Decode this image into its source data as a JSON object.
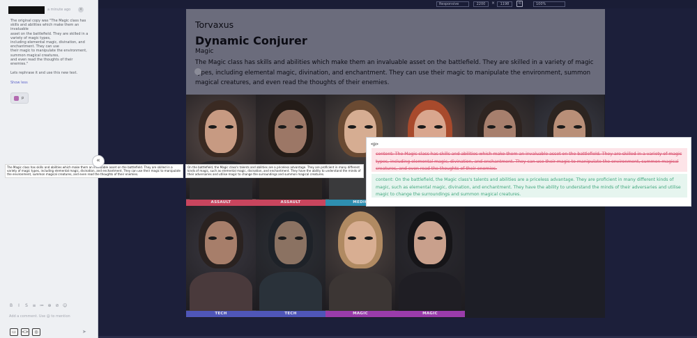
{
  "sidebar": {
    "timestamp": "a minute ago",
    "close_glyph": "×",
    "message": "The original copy was \"The Magic class has\nskills and abilities which make them an\ninvaluable\nasset on the battlefield. They are skilled in a\nvariety of magic types,\nincluding elemental magic, divination, and\nenchantment. They can use\ntheir magic to manipulate the environment,\nsummon magical creatures,\n and even read the thoughts of their enemies.\"",
    "message2": "Lets rephrase it and use this new text.",
    "show_less": "Show less",
    "attachment_label": "p",
    "collapse_glyph": "«",
    "toolbar": [
      "B",
      "I",
      "S",
      "≡",
      "≔",
      "⊕",
      "⊘",
      "☺"
    ],
    "comment_placeholder": "Add a comment. Use @ to mention",
    "bottom_icons": [
      "▭",
      "<>",
      "◎"
    ],
    "send_glyph": "➤"
  },
  "topbar": {
    "viewport": "Responsive",
    "width": "2200",
    "times": "×",
    "height": "1198",
    "zoom": "100%"
  },
  "page": {
    "brand": "Torvaxus",
    "title": "Dynamic Conjurer",
    "class_name": "Magic",
    "class_description": "The Magic class has skills and abilities which make them an invaluable asset on the battlefield. They are skilled in a variety of magic types, including elemental magic, divination, and enchantment. They can use their magic to manipulate the environment, summon magical creatures, and even read the thoughts of their enemies.",
    "cards": [
      {
        "label": "ASSAULT",
        "strip": "#c9455e",
        "bg": "#5a4c48",
        "hair": "#3a2a22",
        "skin": "#c79a82",
        "body": "#2b2a2e"
      },
      {
        "label": "ASSAULT",
        "strip": "#c9455e",
        "bg": "#3a3230",
        "hair": "#241c18",
        "skin": "#9c7766",
        "body": "#2a2523"
      },
      {
        "label": "MEDIC",
        "strip": "#2e8fb0",
        "bg": "#514843",
        "hair": "#6a4a32",
        "skin": "#d6ad92",
        "body": "#3a3a3c"
      },
      {
        "label": "",
        "strip": "#2e8fb0",
        "bg": "#6e5047",
        "hair": "#a84a2c",
        "skin": "#d9a68e",
        "body": "#3f3a38"
      },
      {
        "label": "",
        "strip": "#2e8fb0",
        "bg": "#403836",
        "hair": "#2e2420",
        "skin": "#a77f6d",
        "body": "#2a2628"
      },
      {
        "label": "",
        "strip": "#2e8fb0",
        "bg": "#3c3e48",
        "hair": "#2c2420",
        "skin": "#b98f78",
        "body": "#2a2e3a"
      },
      {
        "label": "TECH",
        "strip": "#4f56b8",
        "bg": "#3a3840",
        "hair": "#2a2220",
        "skin": "#a77e6a",
        "body": "#4a3a3c"
      },
      {
        "label": "TECH",
        "strip": "#4f56b8",
        "bg": "#2c3036",
        "hair": "#1e2228",
        "skin": "#8b7262",
        "body": "#2a323a"
      },
      {
        "label": "MAGIC",
        "strip": "#9a3cab",
        "bg": "#4e4440",
        "hair": "#b08a62",
        "skin": "#d8ae92",
        "body": "#3c3634"
      },
      {
        "label": "MAGIC",
        "strip": "#9a3cab",
        "bg": "#2a2a30",
        "hair": "#161518",
        "skin": "#c9a08c",
        "body": "#1f1e24"
      }
    ]
  },
  "diff": {
    "before_text": "The Magic class has skills and abilities which make them an invaluable asset on the battlefield. They are skilled in a variety of magic types, including elemental magic, divination, and enchantment. They can use their magic to manipulate the environment, summon magical creatures, and even read the thoughts of their enemies.",
    "after_text": "On the battlefield, the Magic class's talents and abilities are a priceless advantage. They are proficient in many different kinds of magic, such as elemental magic, divination, and enchantment. They have the ability to understand the minds of their adversaries and utilise magic to change the surroundings and summon magical creatures.",
    "tag": "<p>",
    "removed": "content: The Magic class has skills and abilities which make them an invaluable asset on the battlefield. They are skilled in a variety of magic types, including elemental magic, divination, and enchantment. They can use their magic to manipulate the environment, summon magical creatures, and even read the thoughts of their enemies.",
    "added": "content: On the battlefield, the Magic class's talents and abilities are a priceless advantage. They are proficient in many different kinds of magic, such as elemental magic, divination, and enchantment. They have the ability to understand the minds of their adversaries and utilise magic to change the surroundings and summon magical creatures."
  }
}
